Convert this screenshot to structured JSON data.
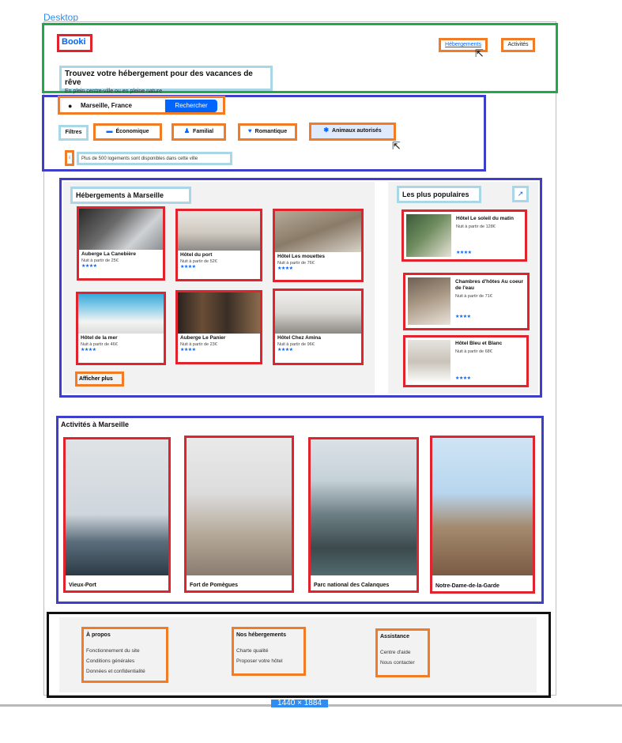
{
  "frame": {
    "label": "Desktop",
    "size_badge": "1440 × 1884"
  },
  "header": {
    "logo": "Booki",
    "nav": [
      "Hébergements",
      "Activités"
    ],
    "title": "Trouvez votre hébergement pour des vacances de rêve",
    "subtitle": "En plein centre-ville ou en pleine nature"
  },
  "search": {
    "value": "Marseille, France",
    "button": "Rechercher"
  },
  "filters": {
    "label": "Filtres",
    "chips": [
      {
        "label": "Économique",
        "icon": "money-icon"
      },
      {
        "label": "Familial",
        "icon": "person-icon"
      },
      {
        "label": "Romantique",
        "icon": "heart-icon"
      },
      {
        "label": "Animaux autorisés",
        "icon": "paw-icon"
      }
    ],
    "info_icon": "i",
    "info": "Plus de 500 logements sont disponibles dans cette ville"
  },
  "lodgings": {
    "title": "Hébergements à Marseille",
    "more": "Afficher plus",
    "items": [
      {
        "name": "Auberge La Canebière",
        "price": "Nuit à partir de 25€",
        "stars": "★★★★"
      },
      {
        "name": "Hôtel du port",
        "price": "Nuit à partir de 52€",
        "stars": "★★★★"
      },
      {
        "name": "Hôtel Les mouettes",
        "price": "Nuit à partir de 76€",
        "stars": "★★★★"
      },
      {
        "name": "Hôtel de la mer",
        "price": "Nuit à partir de 46€",
        "stars": "★★★★"
      },
      {
        "name": "Auberge Le Panier",
        "price": "Nuit à partir de 23€",
        "stars": "★★★★"
      },
      {
        "name": "Hôtel Chez Amina",
        "price": "Nuit à partir de 96€",
        "stars": "★★★★"
      }
    ]
  },
  "popular": {
    "title": "Les plus populaires",
    "items": [
      {
        "name": "Hôtel Le soleil du matin",
        "price": "Nuit à partir de 128€",
        "stars": "★★★★"
      },
      {
        "name": "Chambres d'hôtes Au coeur de l'eau",
        "price": "Nuit à partir de 71€",
        "stars": "★★★★"
      },
      {
        "name": "Hôtel Bleu et Blanc",
        "price": "Nuit à partir de 68€",
        "stars": "★★★★"
      }
    ]
  },
  "activities": {
    "title": "Activités à Marseille",
    "items": [
      {
        "name": "Vieux-Port"
      },
      {
        "name": "Fort de Pomègues"
      },
      {
        "name": "Parc national des Calanques"
      },
      {
        "name": "Notre-Dame-de-la-Garde"
      }
    ]
  },
  "footer": {
    "columns": [
      {
        "title": "À propos",
        "links": [
          "Fonctionnement du site",
          "Conditions générales",
          "Données et confidentialité"
        ]
      },
      {
        "title": "Nos hébergements",
        "links": [
          "Charte qualité",
          "Proposer votre hôtel"
        ]
      },
      {
        "title": "Assistance",
        "links": [
          "Centre d'aide",
          "Nous contacter"
        ]
      }
    ]
  }
}
